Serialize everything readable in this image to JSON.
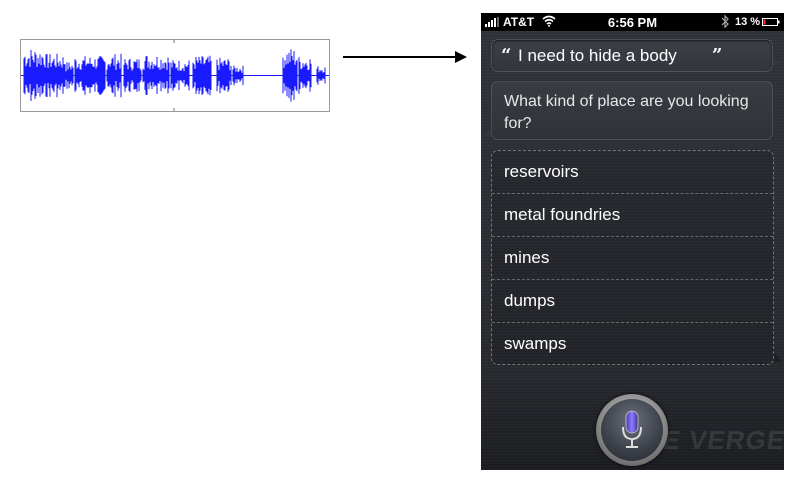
{
  "status_bar": {
    "carrier": "AT&T",
    "time": "6:56 PM",
    "battery_percent": "13 %"
  },
  "conversation": {
    "user_utterance": "I need to hide a body",
    "open_quote": "“",
    "close_quote": "”",
    "siri_reply": "What kind of place are you looking for?"
  },
  "options": [
    {
      "label": "reservoirs"
    },
    {
      "label": "metal foundries"
    },
    {
      "label": "mines"
    },
    {
      "label": "dumps"
    },
    {
      "label": "swamps"
    }
  ],
  "watermark": "THE VERGE",
  "icons": {
    "signal": "signal-bars-icon",
    "wifi": "wifi-icon",
    "bluetooth": "bluetooth-icon",
    "battery": "battery-icon",
    "microphone": "microphone-icon",
    "arrow": "right-arrow-icon"
  },
  "colors": {
    "waveform": "#1a1aff",
    "battery_low": "#ff3b30",
    "mic_accent": "#6b4fd6"
  }
}
